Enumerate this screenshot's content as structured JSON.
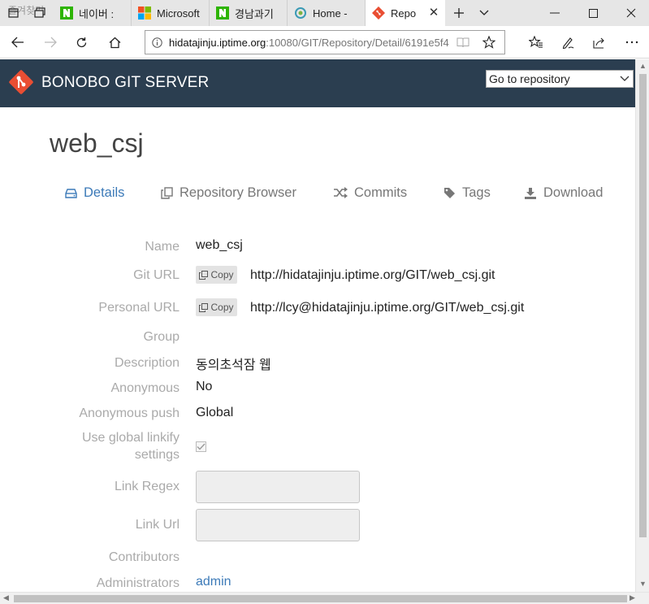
{
  "browser": {
    "faded_text": "즐겨찾기",
    "tabs": [
      {
        "title": "네이버 : ",
        "favicon": "naver-n-icon"
      },
      {
        "title": "Microsoft",
        "favicon": "microsoft-logo-icon"
      },
      {
        "title": "경남과기",
        "favicon": "naver-n-icon"
      },
      {
        "title": "Home - ",
        "favicon": "home-site-icon"
      },
      {
        "title": "Repo",
        "favicon": "bonobo-git-icon",
        "active": true
      }
    ],
    "address": {
      "host": "hidatajinju.iptime.org",
      "path": ":10080/GIT/Repository/Detail/6191e5f4"
    }
  },
  "site": {
    "brand": "BONOBO GIT SERVER",
    "goto_repo": "Go to repository",
    "brand_color": "#2b3e50",
    "logo_color": "#e94e33"
  },
  "repo": {
    "title": "web_csj",
    "tabs": [
      {
        "label": "Details",
        "icon": "hdd-icon",
        "active": true
      },
      {
        "label": "Repository Browser",
        "icon": "copy-icon"
      },
      {
        "label": "Commits",
        "icon": "shuffle-icon"
      },
      {
        "label": "Tags",
        "icon": "tag-icon"
      },
      {
        "label": "Download",
        "icon": "download-icon"
      }
    ],
    "details": {
      "name_label": "Name",
      "name_value": "web_csj",
      "git_url_label": "Git URL",
      "git_url_value": "http://hidatajinju.iptime.org/GIT/web_csj.git",
      "personal_url_label": "Personal URL",
      "personal_url_value": "http://lcy@hidatajinju.iptime.org/GIT/web_csj.git",
      "copy_label": "Copy",
      "group_label": "Group",
      "description_label": "Description",
      "description_value": "동의초석잠 웹",
      "anonymous_label": "Anonymous",
      "anonymous_value": "No",
      "anonymous_push_label": "Anonymous push",
      "anonymous_push_value": "Global",
      "global_linkify_label_line1": "Use global linkify",
      "global_linkify_label_line2": "settings",
      "global_linkify_checked": true,
      "link_regex_label": "Link Regex",
      "link_url_label": "Link Url",
      "contributors_label": "Contributors",
      "administrators_label": "Administrators",
      "administrators_value": "admin"
    }
  }
}
